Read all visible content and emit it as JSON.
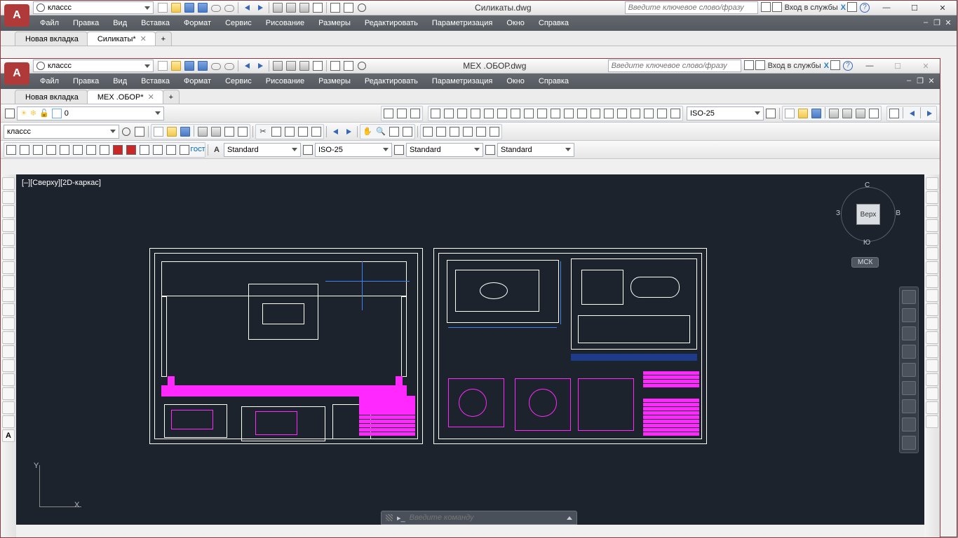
{
  "outer": {
    "workspace": "классс",
    "title": "Силикаты.dwg",
    "search_ph": "Введите ключевое слово/фразу",
    "signin": "Вход в службы",
    "menu": [
      "Файл",
      "Правка",
      "Вид",
      "Вставка",
      "Формат",
      "Сервис",
      "Рисование",
      "Размеры",
      "Редактировать",
      "Параметризация",
      "Окно",
      "Справка"
    ],
    "tabs": [
      {
        "label": "Новая вкладка"
      },
      {
        "label": "Силикаты*",
        "active": true
      }
    ],
    "win": {
      "min": "—",
      "max": "☐",
      "close": "✕"
    }
  },
  "inner": {
    "workspace": "классс",
    "title": "МЕХ .ОБОР.dwg",
    "search_ph": "Введите ключевое слово/фразу",
    "signin": "Вход в службы",
    "menu": [
      "Файл",
      "Правка",
      "Вид",
      "Вставка",
      "Формат",
      "Сервис",
      "Рисование",
      "Размеры",
      "Редактировать",
      "Параметризация",
      "Окно",
      "Справка"
    ],
    "tabs": [
      {
        "label": "Новая вкладка"
      },
      {
        "label": "МЕХ .ОБОР*",
        "active": true
      }
    ],
    "layer_dd": "0",
    "layer_filter": "классс",
    "dimstyle": "ISO-25",
    "style_row": {
      "text": "Standard",
      "dim": "ISO-25",
      "ml": "Standard",
      "tbl": "Standard"
    },
    "viewport": "[–][Сверху][2D-каркас]",
    "axis": {
      "y": "Y",
      "x": "X"
    },
    "viewcube": {
      "face": "Верх",
      "n": "С",
      "s": "Ю",
      "w": "З",
      "e": "В",
      "ucs": "МСК"
    },
    "cmd_ph": "Введите команду",
    "win": {
      "min": "—",
      "max": "☐",
      "close": "✕"
    }
  }
}
